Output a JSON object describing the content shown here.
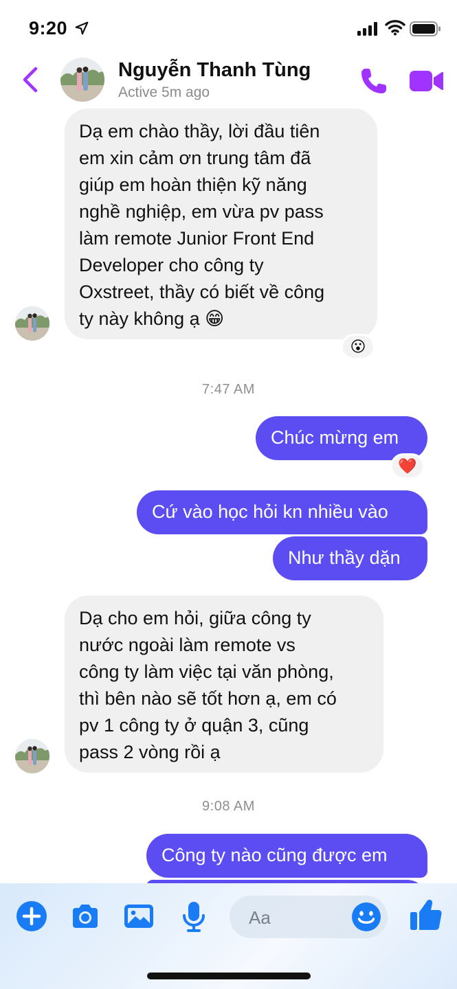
{
  "status_bar": {
    "time": "9:20"
  },
  "header": {
    "name": "Nguyễn Thanh Tùng",
    "status": "Active 5m ago"
  },
  "messages": {
    "m1": {
      "lines": [
        "Dạ em chào thầy, lời đầu tiên",
        "em xin cảm ơn trung tâm đã",
        "giúp em hoàn thiện kỹ năng",
        "nghề nghiệp, em vừa pv pass",
        "làm remote Junior Front End",
        "Developer cho công ty",
        "Oxstreet, thầy có biết về công",
        "ty này không ạ 😁"
      ],
      "reaction": "😮"
    },
    "ts1": "7:47 AM",
    "m2": {
      "text": "Chúc mừng em",
      "reaction": "❤️"
    },
    "m3": {
      "text": "Cứ vào học hỏi kn nhiều vào"
    },
    "m4": {
      "text": "Như thầy dặn"
    },
    "m5": {
      "lines": [
        "Dạ cho em hỏi, giữa công ty",
        "nước ngoài làm remote vs",
        "công ty làm việc tại văn phòng,",
        "thì bên nào sẽ tốt hơn ạ, em có",
        "pv 1 công ty ở quận 3, cũng",
        "pass 2 vòng rồi ạ"
      ]
    },
    "ts2": "9:08 AM",
    "m6": {
      "text": "Công ty nào cũng được em"
    }
  },
  "composer": {
    "placeholder": "Aa"
  },
  "colors": {
    "accent": "#5b4df2",
    "icon_blue": "#1a7cf5",
    "purple": "#a033ff"
  },
  "icons": [
    "back-chevron",
    "phone",
    "video-camera",
    "plus",
    "camera",
    "photo",
    "microphone",
    "smiley",
    "thumbs-up"
  ]
}
